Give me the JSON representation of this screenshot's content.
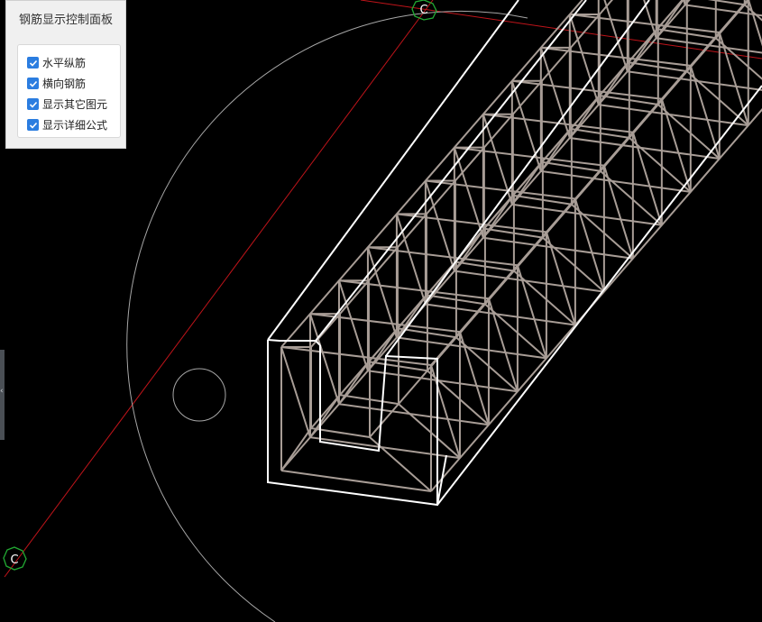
{
  "panel": {
    "title": "钢筋显示控制面板",
    "options": [
      {
        "label": "水平纵筋",
        "checked": true
      },
      {
        "label": "横向钢筋",
        "checked": true
      },
      {
        "label": "显示其它图元",
        "checked": true
      },
      {
        "label": "显示详细公式",
        "checked": true
      }
    ]
  },
  "markers": {
    "top": "C",
    "bottom": "C"
  },
  "side_handle": {
    "glyph": "‹"
  },
  "colors": {
    "background": "#000000",
    "rebar": "#a89d96",
    "outline": "#ffffff",
    "axis_line": "#c0141a",
    "marker": "#22aa33",
    "checkbox": "#2b7de0"
  }
}
